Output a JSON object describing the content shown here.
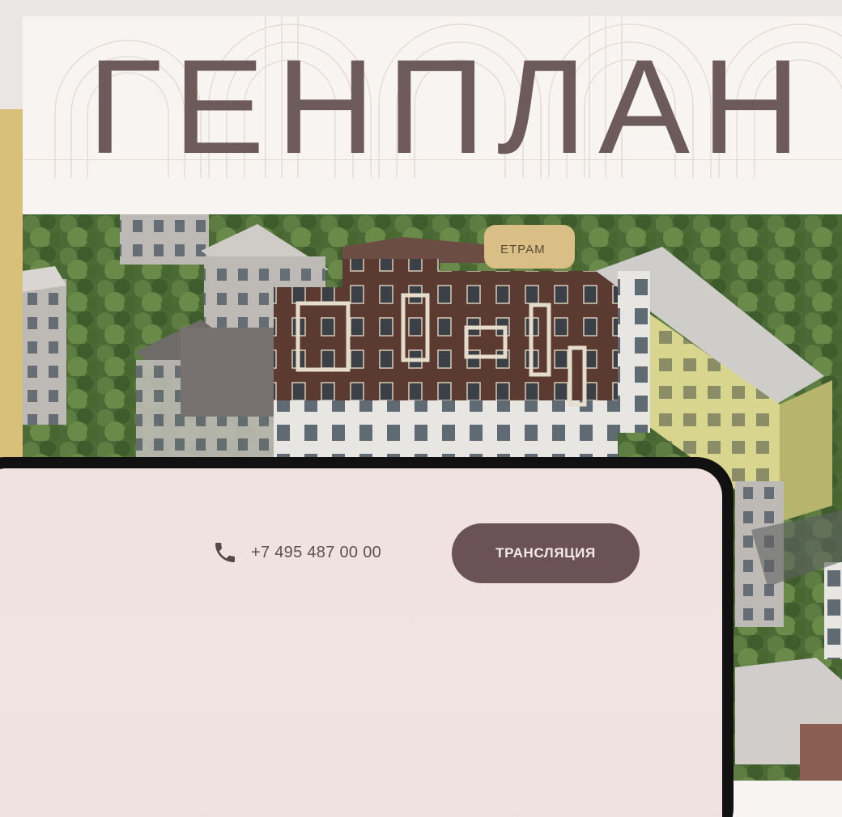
{
  "hero": {
    "title": "ГЕНПЛАН"
  },
  "map": {
    "station_chip": "ЕТРАМ"
  },
  "tablet_header": {
    "phone_icon": "phone-icon",
    "phone_number": "+7 495 487 00 00",
    "broadcast_label": "ТРАНСЛЯЦИЯ"
  },
  "colors": {
    "title": "#6d5a5a",
    "button_bg": "#6b5257",
    "tablet_bg": "#f0e2e0",
    "chip_bg": "#d9be86",
    "page_bg": "#f8f4f1",
    "accent_strip": "#d9c07a"
  }
}
